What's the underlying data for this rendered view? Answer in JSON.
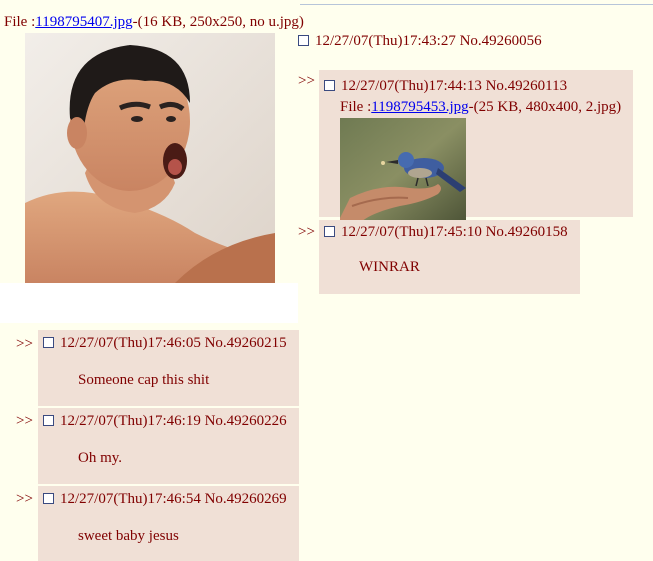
{
  "op": {
    "file_prefix": "File :",
    "file_link": "1198795407.jpg",
    "file_meta": "-(16 KB, 250x250, no u.jpg)",
    "header": "12/27/07(Thu)17:43:27 No.49260056"
  },
  "reply_marker": ">>",
  "replies": [
    {
      "header": "12/27/07(Thu)17:44:13 No.49260113",
      "file_prefix": "File :",
      "file_link": "1198795453.jpg",
      "file_meta": "-(25 KB, 480x400, 2.jpg)",
      "body": ""
    },
    {
      "header": "12/27/07(Thu)17:45:10 No.49260158",
      "body": "WINRAR"
    },
    {
      "header": "12/27/07(Thu)17:46:05 No.49260215",
      "body": "Someone cap this shit"
    },
    {
      "header": "12/27/07(Thu)17:46:19 No.49260226",
      "body": "Oh my."
    },
    {
      "header": "12/27/07(Thu)17:46:54 No.49260269",
      "body": "sweet baby jesus"
    }
  ],
  "colors": {
    "background": "#FFFFEE",
    "reply_background": "#F0E0D6",
    "text": "#800000",
    "link": "#0000EE"
  }
}
